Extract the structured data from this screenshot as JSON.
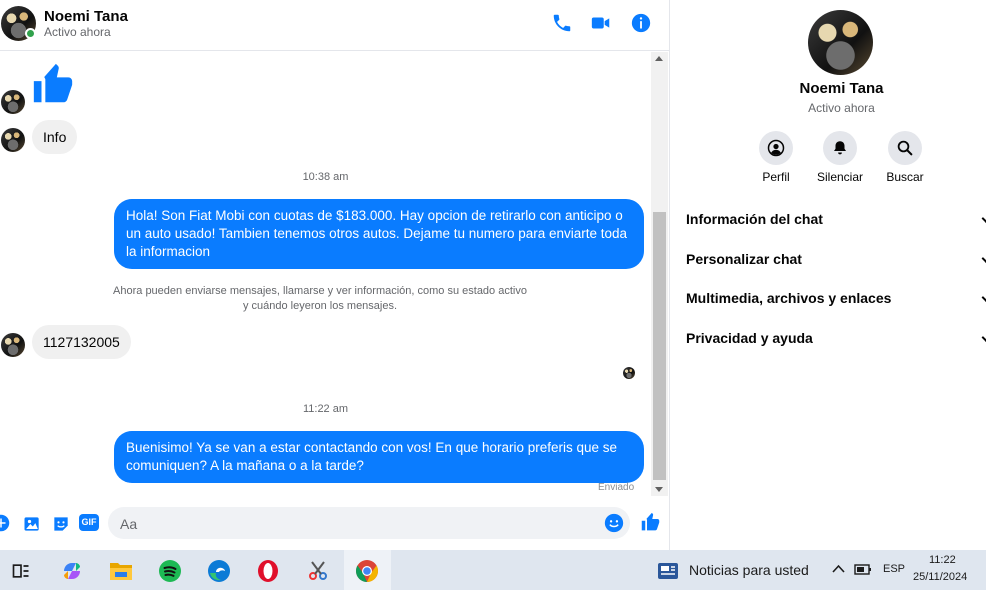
{
  "header": {
    "contact_name": "Noemi Tana",
    "status": "Activo ahora",
    "icons": [
      "phone-icon",
      "video-icon",
      "info-icon"
    ]
  },
  "messages": {
    "like_emoji": "thumbs-up-icon",
    "info_msg": "Info",
    "time1": "10:38 am",
    "out1": "Hola! Son Fiat Mobi con cuotas de $183.000. Hay opcion de retirarlo con anticipo o un auto usado! Tambien tenemos otros autos. Dejame tu numero para enviarte toda la informacion",
    "system_line1": "Ahora pueden enviarse mensajes, llamarse y ver información, como su estado activo",
    "system_line2": "y cuándo leyeron los mensajes.",
    "in_number": "1127132005",
    "time2": "11:22 am",
    "out2": "Buenisimo! Ya se van a estar contactando con vos! En que horario preferis que se comuniquen? A la mañana o a la tarde?",
    "sent_label": "Enviado"
  },
  "composer": {
    "placeholder": "Aa",
    "gif_label": "GIF"
  },
  "side": {
    "name": "Noemi Tana",
    "status": "Activo ahora",
    "actions": [
      {
        "label": "Perfil",
        "icon": "profile-icon"
      },
      {
        "label": "Silenciar",
        "icon": "bell-icon"
      },
      {
        "label": "Buscar",
        "icon": "search-icon"
      }
    ],
    "sections": [
      "Información del chat",
      "Personalizar chat",
      "Multimedia, archivos y enlaces",
      "Privacidad y ayuda"
    ]
  },
  "taskbar": {
    "news": "Noticias para usted",
    "lang": "ESP",
    "time": "11:22",
    "date": "25/11/2024"
  },
  "colors": {
    "accent": "#0a7cff",
    "online": "#31a24c"
  }
}
